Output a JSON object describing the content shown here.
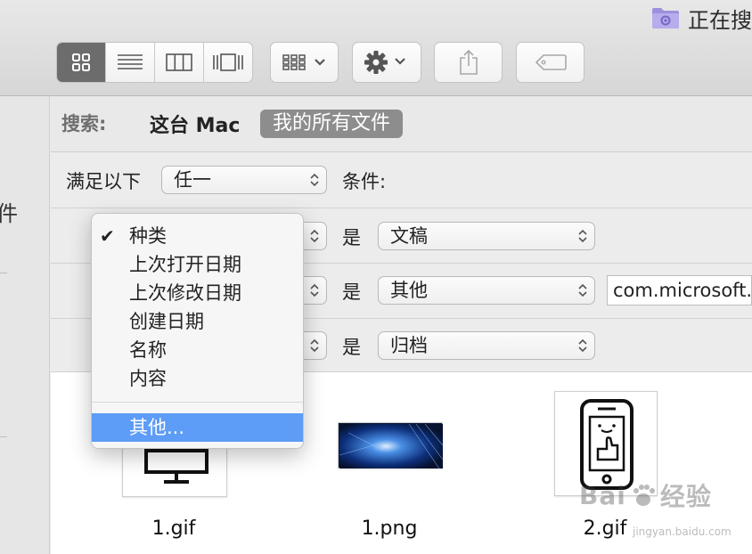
{
  "window": {
    "title": "正在搜"
  },
  "toolbar": {
    "view_modes": [
      {
        "name": "icon-view",
        "active": true
      },
      {
        "name": "list-view",
        "active": false
      },
      {
        "name": "column-view",
        "active": false
      },
      {
        "name": "gallery-view",
        "active": false
      }
    ]
  },
  "scope": {
    "label": "搜索:",
    "this_mac": "这台 Mac",
    "all_files": "我的所有文件"
  },
  "criteria": {
    "match_label": "满足以下",
    "match_value": "任一",
    "conditions_label": "条件:",
    "rows": [
      {
        "attribute": "种类",
        "operator": "是",
        "value": "文稿"
      },
      {
        "attribute": "种类",
        "operator": "是",
        "value": "其他",
        "text": "com.microsoft."
      },
      {
        "attribute": "种类",
        "operator": "是",
        "value": "归档"
      }
    ]
  },
  "attribute_menu": {
    "items": [
      {
        "label": "种类",
        "checked": true
      },
      {
        "label": "上次打开日期",
        "checked": false
      },
      {
        "label": "上次修改日期",
        "checked": false
      },
      {
        "label": "创建日期",
        "checked": false
      },
      {
        "label": "名称",
        "checked": false
      },
      {
        "label": "内容",
        "checked": false
      }
    ],
    "other": "其他..."
  },
  "results": [
    {
      "name": "1.gif"
    },
    {
      "name": "1.png"
    },
    {
      "name": "2.gif"
    }
  ],
  "sidebar": {
    "partial_glyph": "件"
  },
  "watermark": {
    "brand": "Bai",
    "brand2": "经验",
    "url": "jingyan.baidu.com"
  },
  "colors": {
    "accent": "#5d9cf7",
    "scope_pill": "#8d8d8d",
    "active_segment": "#6c6c6c"
  }
}
